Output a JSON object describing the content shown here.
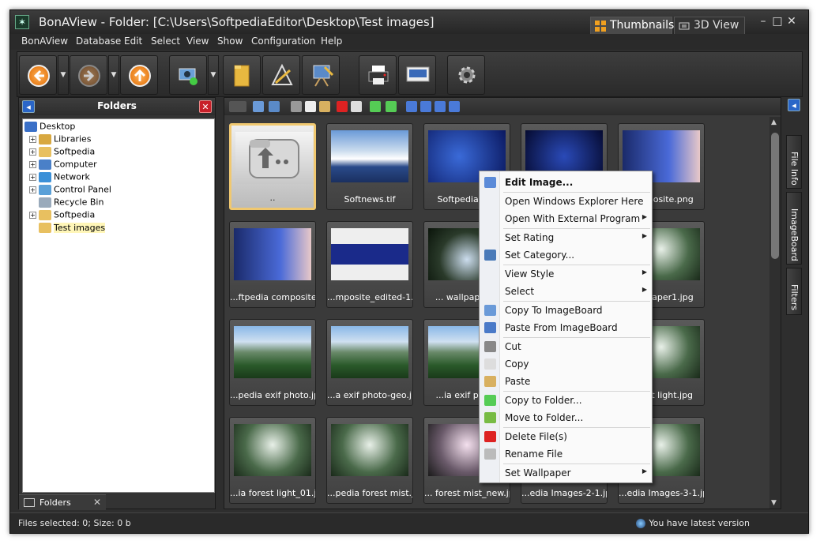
{
  "window": {
    "title": "BonAView - Folder: [C:\\Users\\SoftpediaEditor\\Desktop\\Test images]",
    "view_tabs": [
      "Thumbnails",
      "3D View"
    ],
    "controls": [
      "–",
      "□",
      "✕"
    ]
  },
  "menu": [
    "BonAView",
    "Database",
    "Edit",
    "Select",
    "View",
    "Show",
    "Configuration",
    "Help"
  ],
  "folders_panel": {
    "title": "Folders",
    "footer_tab": "Folders",
    "tree": [
      {
        "label": "Desktop",
        "expander": "",
        "indent": 0,
        "selected": false,
        "icon": "desktop-icon"
      },
      {
        "label": "Libraries",
        "expander": "+",
        "indent": 1,
        "selected": false,
        "icon": "libraries-icon"
      },
      {
        "label": "Softpedia",
        "expander": "+",
        "indent": 1,
        "selected": false,
        "icon": "user-folder-icon"
      },
      {
        "label": "Computer",
        "expander": "+",
        "indent": 1,
        "selected": false,
        "icon": "computer-icon"
      },
      {
        "label": "Network",
        "expander": "+",
        "indent": 1,
        "selected": false,
        "icon": "network-icon"
      },
      {
        "label": "Control Panel",
        "expander": "+",
        "indent": 1,
        "selected": false,
        "icon": "control-panel-icon"
      },
      {
        "label": "Recycle Bin",
        "expander": "",
        "indent": 1,
        "selected": false,
        "icon": "recycle-bin-icon"
      },
      {
        "label": "Softpedia",
        "expander": "+",
        "indent": 1,
        "selected": false,
        "icon": "folder-icon"
      },
      {
        "label": "Test images",
        "expander": "",
        "indent": 1,
        "selected": true,
        "icon": "folder-icon"
      }
    ]
  },
  "thumbnails": [
    {
      "caption": "..",
      "kind": "parent-folder",
      "selected": true
    },
    {
      "caption": "Softnews.tif",
      "kind": "sea",
      "selected": false
    },
    {
      "caption": "Softpedia - sc",
      "kind": "softpedia",
      "selected": false
    },
    {
      "caption": "",
      "kind": "dark-blue",
      "selected": false
    },
    {
      "caption": "composite.png",
      "kind": "composite",
      "selected": false
    },
    {
      "caption": "...ftpedia composite.tif",
      "kind": "composite",
      "selected": false
    },
    {
      "caption": "...mposite_edited-1.tif",
      "kind": "composite2",
      "selected": false
    },
    {
      "caption": "... wallpaper w",
      "kind": "forest-dark",
      "selected": false
    },
    {
      "caption": "",
      "kind": "forest-dark",
      "selected": false
    },
    {
      "caption": "wallpaper1.jpg",
      "kind": "forest",
      "selected": false
    },
    {
      "caption": "...pedia exif photo.jpg",
      "kind": "mountain",
      "selected": false
    },
    {
      "caption": "...a exif photo-geo.jpg",
      "kind": "mountain",
      "selected": false
    },
    {
      "caption": "...ia exif photo",
      "kind": "mountain",
      "selected": false
    },
    {
      "caption": "",
      "kind": "forest",
      "selected": false
    },
    {
      "caption": "forest light.jpg",
      "kind": "forest",
      "selected": false
    },
    {
      "caption": "...ia forest light_01.jpg",
      "kind": "forest",
      "selected": false
    },
    {
      "caption": "...pedia forest mist.jpg",
      "kind": "forest",
      "selected": false
    },
    {
      "caption": "... forest mist_new.jpg",
      "kind": "forest-pink",
      "selected": false
    },
    {
      "caption": "...edia Images-2-1.jpg",
      "kind": "forest",
      "selected": false
    },
    {
      "caption": "...edia Images-3-1.jpg",
      "kind": "forest",
      "selected": false
    }
  ],
  "side_tabs": [
    "File Info",
    "ImageBoard",
    "Filters"
  ],
  "context_menu": {
    "items": [
      {
        "label": "Edit Image...",
        "bold": true,
        "submenu": false,
        "icon": "edit-image-icon",
        "sep_after": true
      },
      {
        "label": "Open Windows Explorer Here",
        "bold": false,
        "submenu": false,
        "icon": "",
        "sep_after": false
      },
      {
        "label": "Open With External Program",
        "bold": false,
        "submenu": true,
        "icon": "",
        "sep_after": true
      },
      {
        "label": "Set Rating",
        "bold": false,
        "submenu": true,
        "icon": "",
        "sep_after": false
      },
      {
        "label": "Set Category...",
        "bold": false,
        "submenu": false,
        "icon": "category-icon",
        "sep_after": true
      },
      {
        "label": "View Style",
        "bold": false,
        "submenu": true,
        "icon": "",
        "sep_after": false
      },
      {
        "label": "Select",
        "bold": false,
        "submenu": true,
        "icon": "",
        "sep_after": true
      },
      {
        "label": "Copy To ImageBoard",
        "bold": false,
        "submenu": false,
        "icon": "copy-to-imageboard-icon",
        "sep_after": false
      },
      {
        "label": "Paste From ImageBoard",
        "bold": false,
        "submenu": false,
        "icon": "paste-from-imageboard-icon",
        "sep_after": true
      },
      {
        "label": "Cut",
        "bold": false,
        "submenu": false,
        "icon": "cut-icon",
        "sep_after": false
      },
      {
        "label": "Copy",
        "bold": false,
        "submenu": false,
        "icon": "copy-icon",
        "sep_after": false
      },
      {
        "label": "Paste",
        "bold": false,
        "submenu": false,
        "icon": "paste-icon",
        "sep_after": true
      },
      {
        "label": "Copy to Folder...",
        "bold": false,
        "submenu": false,
        "icon": "copy-to-folder-icon",
        "sep_after": false
      },
      {
        "label": "Move to Folder...",
        "bold": false,
        "submenu": false,
        "icon": "move-to-folder-icon",
        "sep_after": true
      },
      {
        "label": "Delete File(s)",
        "bold": false,
        "submenu": false,
        "icon": "delete-icon",
        "sep_after": false
      },
      {
        "label": "Rename File",
        "bold": false,
        "submenu": false,
        "icon": "rename-icon",
        "sep_after": true
      },
      {
        "label": "Set Wallpaper",
        "bold": false,
        "submenu": true,
        "icon": "",
        "sep_after": false
      }
    ]
  },
  "status": {
    "left": "Files selected: 0; Size: 0 b",
    "right": "You have latest version"
  },
  "colors": {
    "accent_orange": "#e8780a",
    "selection_border": "#f0c870",
    "panel_blue": "#2a66c8"
  }
}
